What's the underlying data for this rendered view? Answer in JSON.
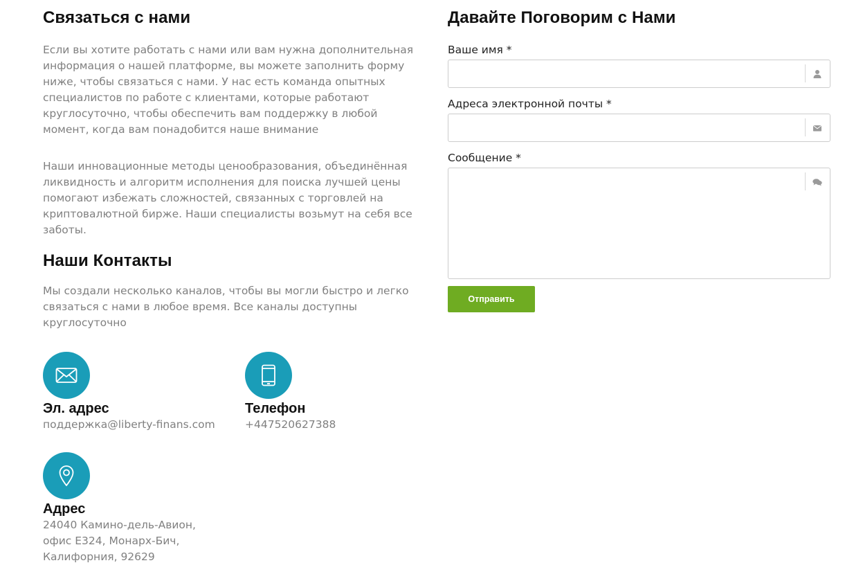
{
  "contact": {
    "title": "Связаться с нами",
    "paragraph1": "Если вы хотите работать с нами или вам нужна дополнительная информация о нашей платформе, вы можете заполнить форму ниже, чтобы связаться с нами. У нас есть команда опытных специалистов по работе с клиентами, которые работают круглосуточно, чтобы обеспечить вам поддержку в любой момент, когда вам понадобится наше внимание",
    "paragraph2": "Наши инновационные методы ценообразования, объединённая ликвидность и алгоритм исполнения для поиска лучшей цены помогают избежать сложностей, связанных с торговлей на криптовалютной бирже. Наши специалисты возьмут на себя все заботы."
  },
  "contacts": {
    "title": "Наши Контакты",
    "paragraph": "Мы создали несколько каналов, чтобы вы могли быстро и легко связаться с нами в любое время. Все каналы доступны круглосуточно",
    "email": {
      "icon": "envelope-icon",
      "title": "Эл. адрес",
      "value": "поддержка@liberty-finans.com"
    },
    "phone": {
      "icon": "mobile-phone-icon",
      "title": "Телефон",
      "value": "+447520627388"
    },
    "address": {
      "icon": "map-pin-icon",
      "title": "Адрес",
      "lines": [
        "24040 Камино-дель-Авион,",
        "офис Е324, Монарх-Бич,",
        "Калифорния, 92629"
      ]
    }
  },
  "form": {
    "title": "Давайте Поговорим с Нами",
    "name_label": "Ваше имя *",
    "name_value": "",
    "name_icon": "user-icon",
    "email_label": "Адреса электронной почты *",
    "email_value": "",
    "email_icon": "envelope-small-icon",
    "message_label": "Сообщение *",
    "message_value": "",
    "message_icon": "chat-bubbles-icon",
    "submit_label": "Отправить"
  },
  "colors": {
    "icon_circle": "#1a9db8",
    "submit_button": "#6fac22",
    "body_text": "#808080"
  }
}
